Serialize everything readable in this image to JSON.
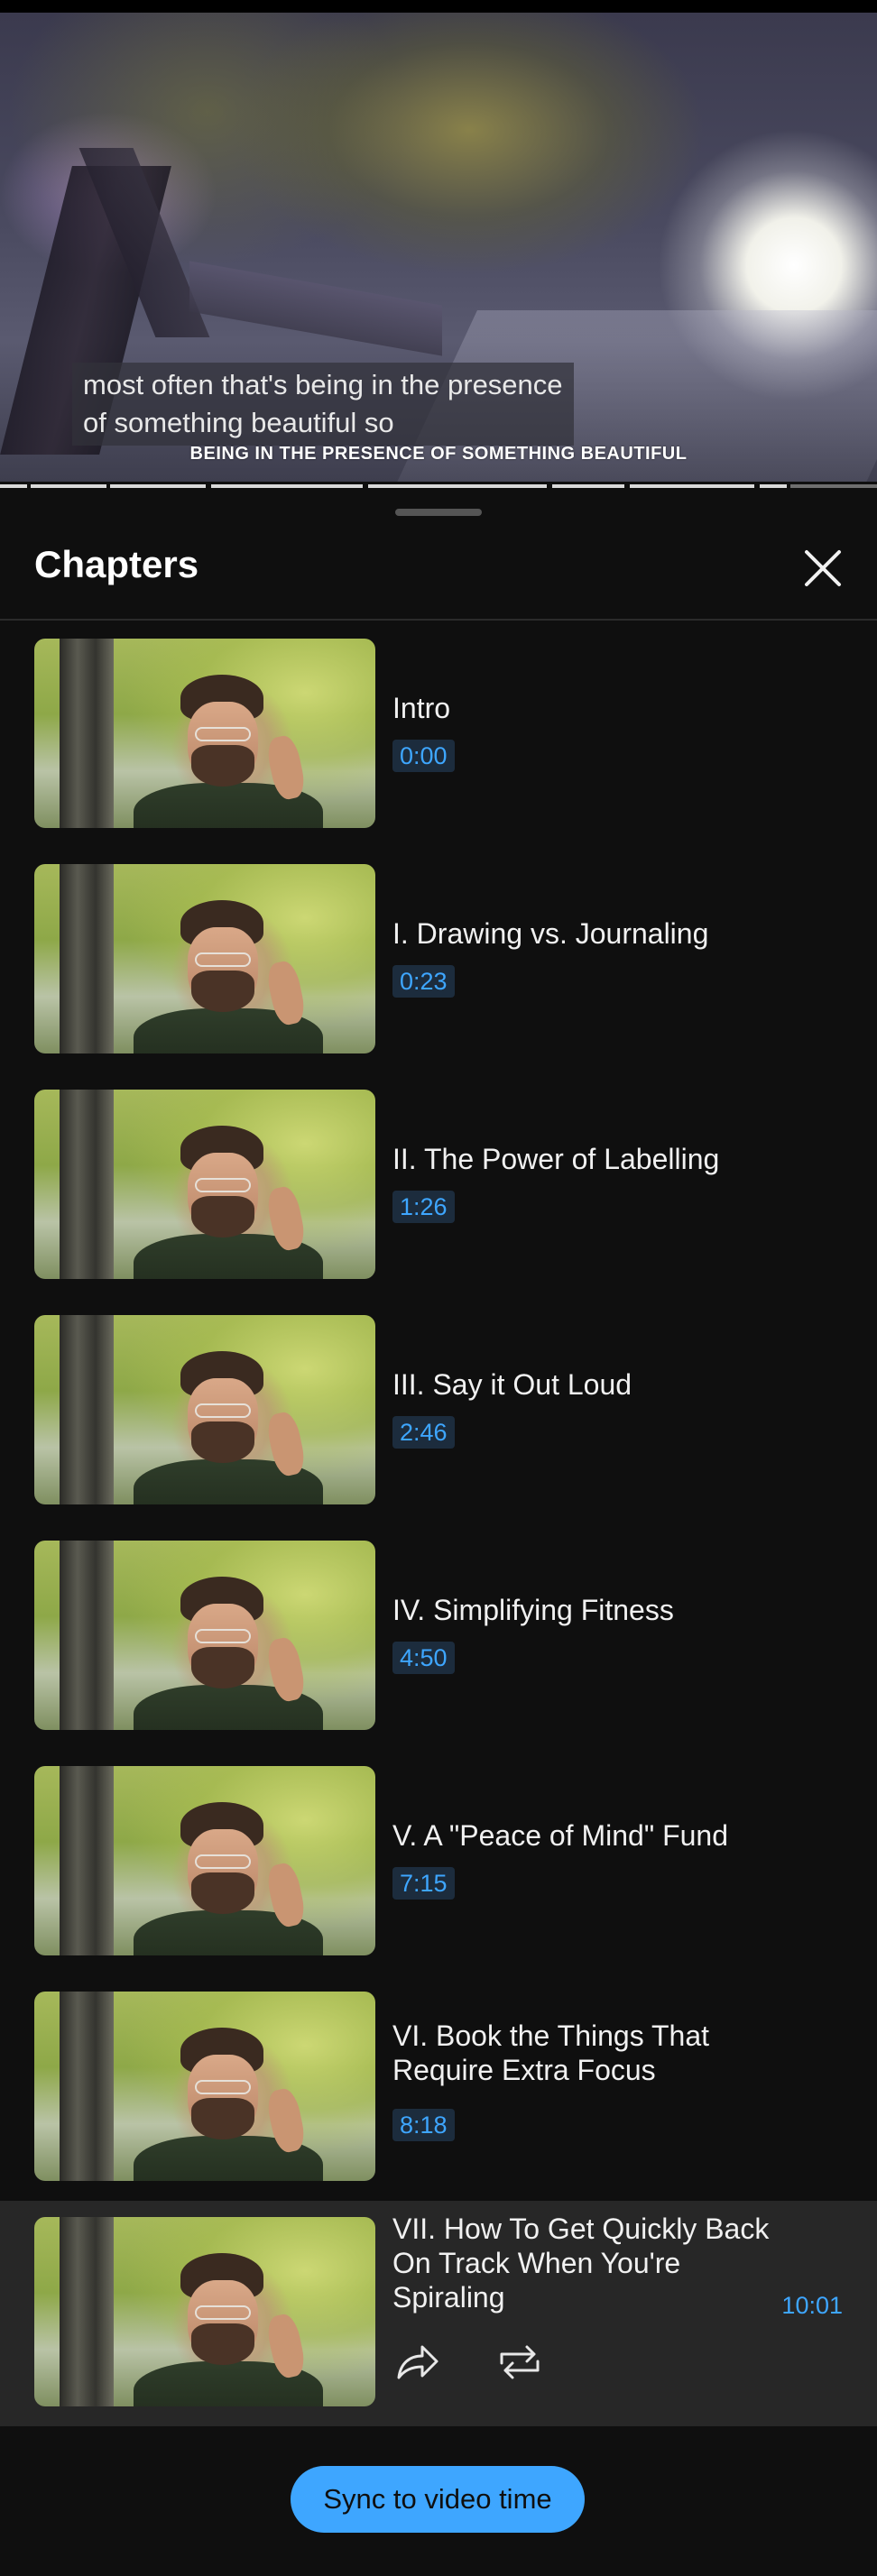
{
  "video": {
    "caption_lines": [
      "most often that's being in the presence",
      "of something beautiful so"
    ],
    "burned_in_text": "BEING IN THE PRESENCE OF SOMETHING BEAUTIFUL"
  },
  "sheet": {
    "title": "Chapters",
    "close_icon": "close-icon"
  },
  "chapters": [
    {
      "title": "Intro",
      "time": "0:00"
    },
    {
      "title": "I. Drawing vs. Journaling",
      "time": "0:23"
    },
    {
      "title": "II. The Power of Labelling",
      "time": "1:26"
    },
    {
      "title": "III. Say it Out Loud",
      "time": "2:46"
    },
    {
      "title": "IV. Simplifying Fitness",
      "time": "4:50"
    },
    {
      "title": "V. A \"Peace of Mind\" Fund",
      "time": "7:15"
    },
    {
      "title": "VI. Book the Things That Require Extra Focus",
      "time": "8:18"
    },
    {
      "title": "VII. How To Get Quickly Back On Track When You're Spiraling",
      "time": "10:01",
      "active": true,
      "actions": [
        "share-icon",
        "repeat-icon"
      ]
    }
  ],
  "sync_button": {
    "label": "Sync to video time"
  },
  "colors": {
    "accent": "#3ea6ff",
    "background": "#0f0f0f",
    "active_row": "#272727"
  }
}
